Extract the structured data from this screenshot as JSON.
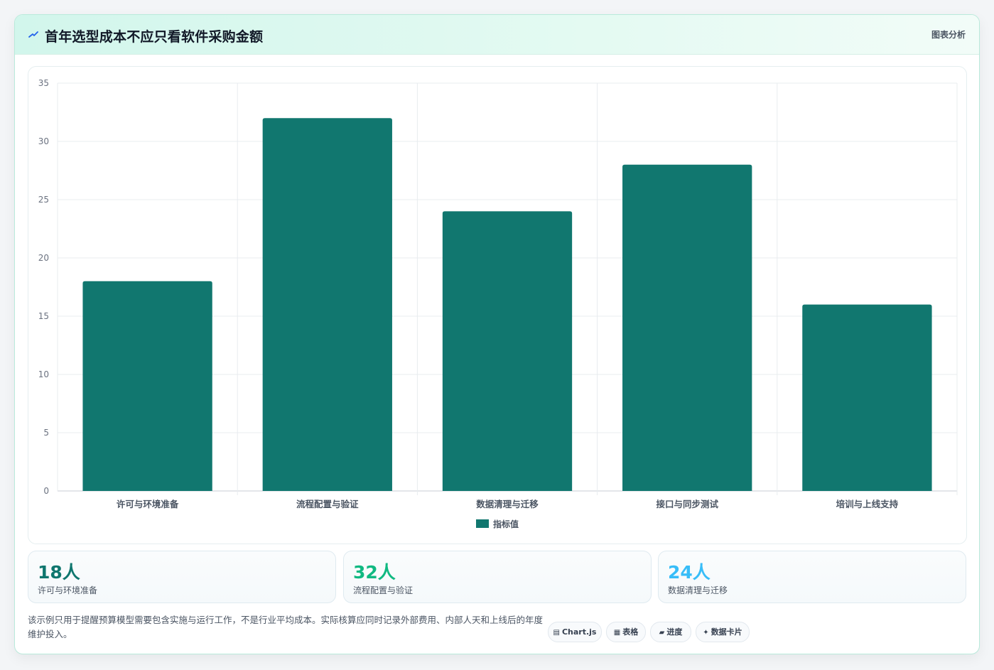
{
  "header": {
    "title": "首年选型成本不应只看软件采购金额",
    "action_label": "图表分析"
  },
  "chart_data": {
    "type": "bar",
    "categories": [
      "许可与环境准备",
      "流程配置与验证",
      "数据清理与迁移",
      "接口与同步测试",
      "培训与上线支持"
    ],
    "series": [
      {
        "name": "指标值",
        "values": [
          18,
          32,
          24,
          28,
          16
        ],
        "color": "#11776f"
      }
    ],
    "ylim": [
      0,
      35
    ],
    "yticks": [
      0,
      5,
      10,
      15,
      20,
      25,
      30,
      35
    ],
    "grid": true,
    "legend_position": "bottom"
  },
  "kpis": [
    {
      "value": "18人",
      "label": "许可与环境准备",
      "color": "#0f766e"
    },
    {
      "value": "32人",
      "label": "流程配置与验证",
      "color": "#10b981"
    },
    {
      "value": "24人",
      "label": "数据清理与迁移",
      "color": "#38bdf8"
    }
  ],
  "note": "该示例只用于提醒预算模型需要包含实施与运行工作，不是行业平均成本。实际核算应同时记录外部费用、内部人天和上线后的年度维护投入。",
  "pills": [
    {
      "icon": "▤",
      "label": "Chart.js"
    },
    {
      "icon": "▦",
      "label": "表格"
    },
    {
      "icon": "▰",
      "label": "进度"
    },
    {
      "icon": "✦",
      "label": "数据卡片"
    }
  ]
}
